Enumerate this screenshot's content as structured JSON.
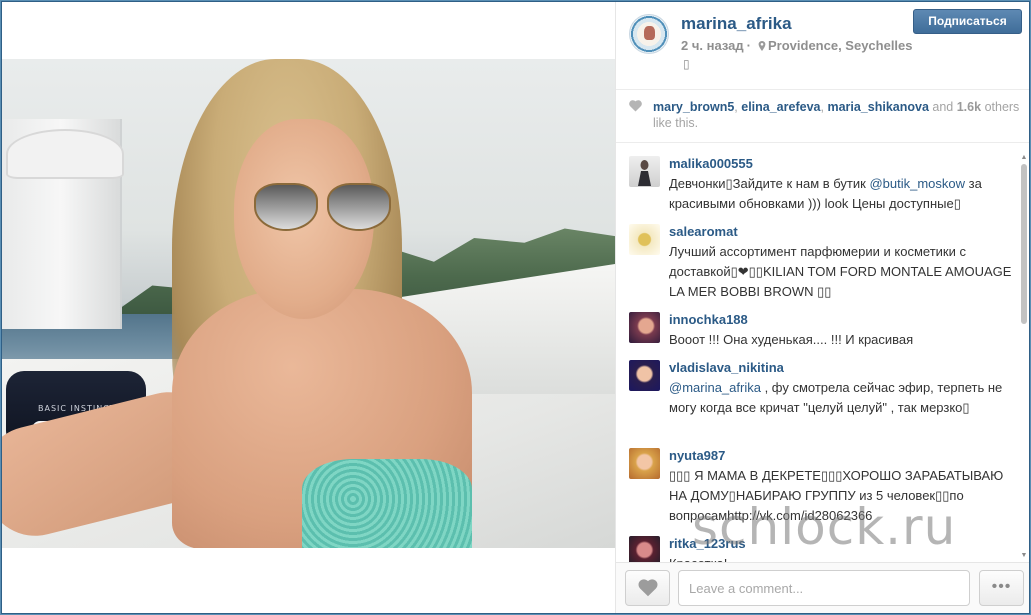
{
  "post": {
    "username": "marina_afrika",
    "time_ago": "2 ч. назад",
    "separator": "·",
    "location": "Providence, Seychelles",
    "caption_glyph": "▯",
    "follow_label": "Подписаться"
  },
  "photo": {
    "bag_label": "BASIC INSTINCT"
  },
  "likes": {
    "users": [
      "mary_brown5",
      "elina_arefeva",
      "maria_shikanova"
    ],
    "comma": ",",
    "and": "and",
    "count": "1.6k",
    "suffix": "others like this."
  },
  "comments": [
    {
      "user": "malika000555",
      "text_parts": [
        "Девчонки▯Зайдите к нам в бутик ",
        "@butik_moskow",
        " за красивыми обновками ))) look Цены доступные▯"
      ]
    },
    {
      "user": "salearomat",
      "text_parts": [
        "Лучший ассортимент парфюмерии и косметики с доставкой▯❤▯▯KILIAN TOM FORD MONTALE AMOUAGE LA MER BOBBI BROWN ▯▯"
      ]
    },
    {
      "user": "innochka188",
      "text_parts": [
        "Вооот !!! Она худенькая.... !!! И красивая"
      ]
    },
    {
      "user": "vladislava_nikitina",
      "text_parts": [
        "@marina_afrika",
        " , фу смотрела сейчас эфир, терпеть не могу когда все кричат \"целуй целуй\" , так мерзко▯"
      ]
    },
    {
      "user": "nyuta987",
      "text_parts": [
        "▯▯▯ Я МАМА В ДЕКРЕТЕ▯▯▯ХОРОШО ЗАРАБАТЫВАЮ НА ДОМУ▯НАБИРАЮ ГРУППУ из 5 человек▯▯по вопросамhttp://vk.com/id28062366"
      ]
    },
    {
      "user": "ritka_123rus",
      "text_parts": [
        "Красотка!"
      ]
    }
  ],
  "footer": {
    "comment_placeholder": "Leave a comment...",
    "more_label": "•••"
  },
  "watermark": "schlock.ru",
  "colors": {
    "link": "#2b5a86",
    "follow_button": "#4a77a3",
    "frame": "#2f5f86"
  },
  "icons": {
    "location": "location-pin-icon",
    "heart": "heart-icon",
    "more": "ellipsis-icon"
  }
}
